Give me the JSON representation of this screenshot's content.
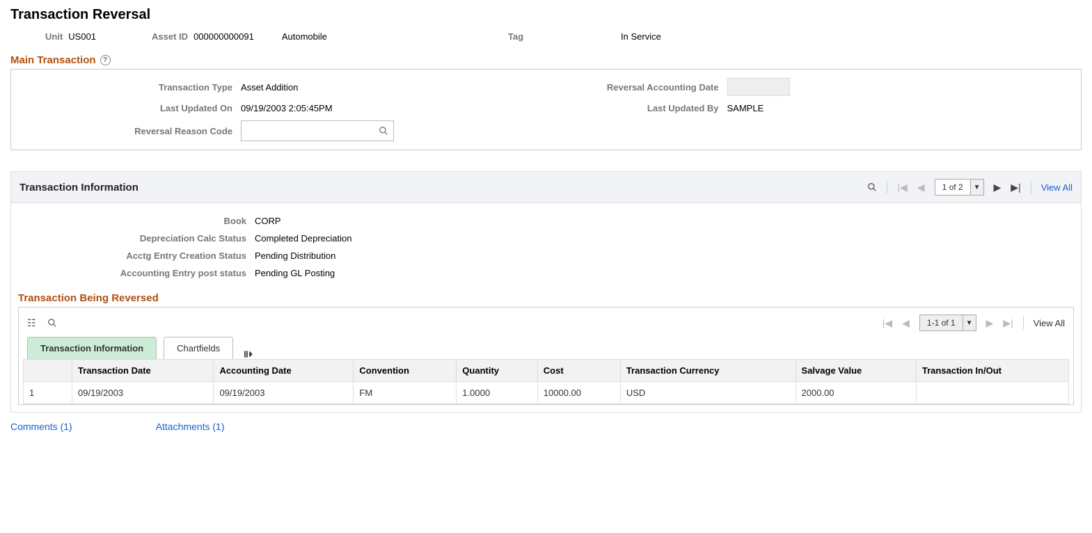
{
  "title": "Transaction Reversal",
  "header": {
    "unit_label": "Unit",
    "unit_value": "US001",
    "asset_id_label": "Asset ID",
    "asset_id_value": "000000000091",
    "asset_desc": "Automobile",
    "tag_label": "Tag",
    "tag_value": "",
    "status": "In Service"
  },
  "main_txn": {
    "section_title": "Main Transaction",
    "txn_type_label": "Transaction Type",
    "txn_type_value": "Asset Addition",
    "rev_acct_date_label": "Reversal Accounting Date",
    "last_updated_on_label": "Last Updated On",
    "last_updated_on_value": "09/19/2003  2:05:45PM",
    "last_updated_by_label": "Last Updated By",
    "last_updated_by_value": "SAMPLE",
    "reason_code_label": "Reversal Reason Code"
  },
  "txn_info": {
    "panel_title": "Transaction Information",
    "pager": "1 of 2",
    "view_all": "View All",
    "book_label": "Book",
    "book_value": "CORP",
    "dep_calc_label": "Depreciation Calc Status",
    "dep_calc_value": "Completed Depreciation",
    "acctg_create_label": "Acctg Entry Creation Status",
    "acctg_create_value": "Pending Distribution",
    "acctg_post_label": "Accounting Entry post status",
    "acctg_post_value": "Pending GL Posting"
  },
  "reversed": {
    "section_title": "Transaction Being Reversed",
    "pager": "1-1 of 1",
    "view_all": "View All",
    "tabs": {
      "info": "Transaction Information",
      "cf": "Chartfields"
    },
    "cols": {
      "txn_date": "Transaction Date",
      "acct_date": "Accounting Date",
      "conv": "Convention",
      "qty": "Quantity",
      "cost": "Cost",
      "curr": "Transaction Currency",
      "salv": "Salvage Value",
      "inout": "Transaction In/Out"
    },
    "rows": [
      {
        "n": "1",
        "txn_date": "09/19/2003",
        "acct_date": "09/19/2003",
        "conv": "FM",
        "qty": "1.0000",
        "cost": "10000.00",
        "curr": "USD",
        "salv": "2000.00",
        "inout": ""
      }
    ]
  },
  "footer": {
    "comments": "Comments (1)",
    "attachments": "Attachments (1)"
  }
}
